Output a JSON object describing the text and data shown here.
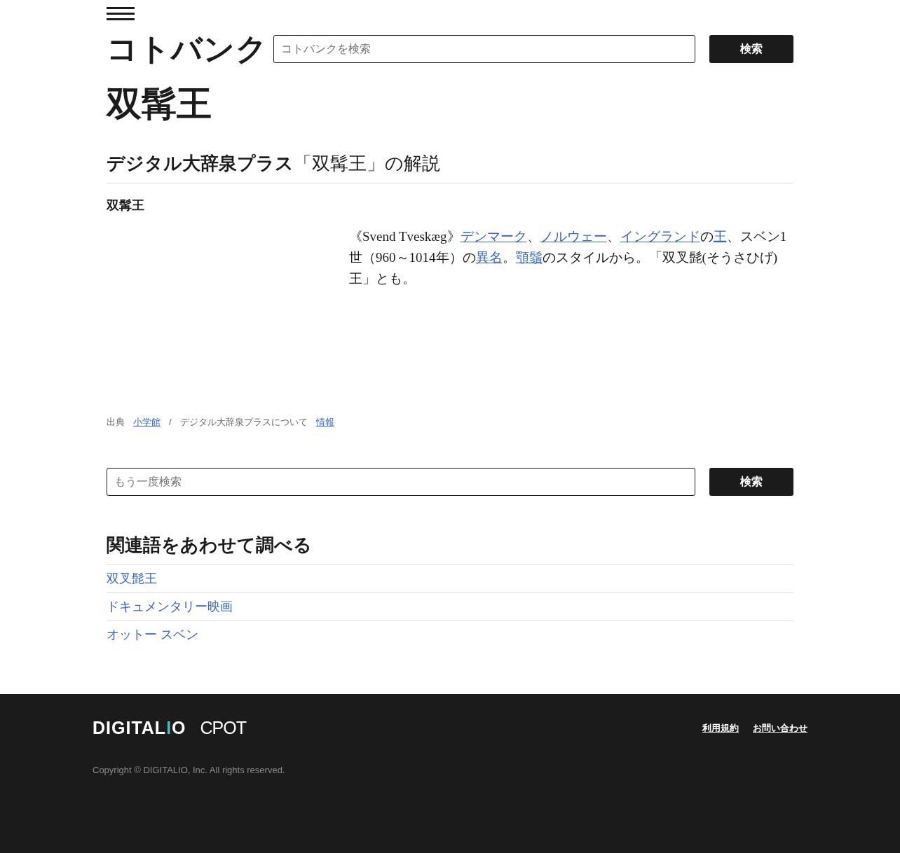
{
  "header": {
    "logo": "コトバンク",
    "search": {
      "placeholder": "コトバンクを検索"
    },
    "search_button": "検索"
  },
  "title": "双髯王",
  "section": {
    "source_name": "デジタル大辞泉プラス",
    "heading_rest": "「双髯王」の解説",
    "term": "双髯王",
    "definition": [
      {
        "kind": "text",
        "text": "《Svend Tveskæg》"
      },
      {
        "kind": "link",
        "text": "デンマーク"
      },
      {
        "kind": "text",
        "text": "、"
      },
      {
        "kind": "link",
        "text": "ノルウェー"
      },
      {
        "kind": "text",
        "text": "、"
      },
      {
        "kind": "link",
        "text": "イングランド"
      },
      {
        "kind": "text",
        "text": "の"
      },
      {
        "kind": "link",
        "text": "王"
      },
      {
        "kind": "text",
        "text": "、スベン1世（960～1014年）の"
      },
      {
        "kind": "link",
        "text": "異名"
      },
      {
        "kind": "text",
        "text": "。"
      },
      {
        "kind": "link",
        "text": "顎鬚"
      },
      {
        "kind": "text",
        "text": "のスタイルから。「双叉髭(そうさひげ)王」とも。"
      }
    ],
    "source": {
      "label": "出典",
      "publisher": "小学館",
      "separator": "/",
      "about": "デジタル大辞泉プラスについて",
      "info": "情報"
    }
  },
  "search_again": {
    "placeholder": "もう一度検索",
    "button": "検索"
  },
  "related": {
    "heading": "関連語をあわせて調べる",
    "items": [
      "双叉髭王",
      "ドキュメンタリー映画",
      "オットー スベン"
    ]
  },
  "footer": {
    "logos": [
      "DIGITAL",
      "I",
      "O",
      "CPOT"
    ],
    "links": [
      "利用規約",
      "お問い合わせ"
    ],
    "copyright": "Copyright © DIGITALIO, Inc. All rights reserved."
  }
}
